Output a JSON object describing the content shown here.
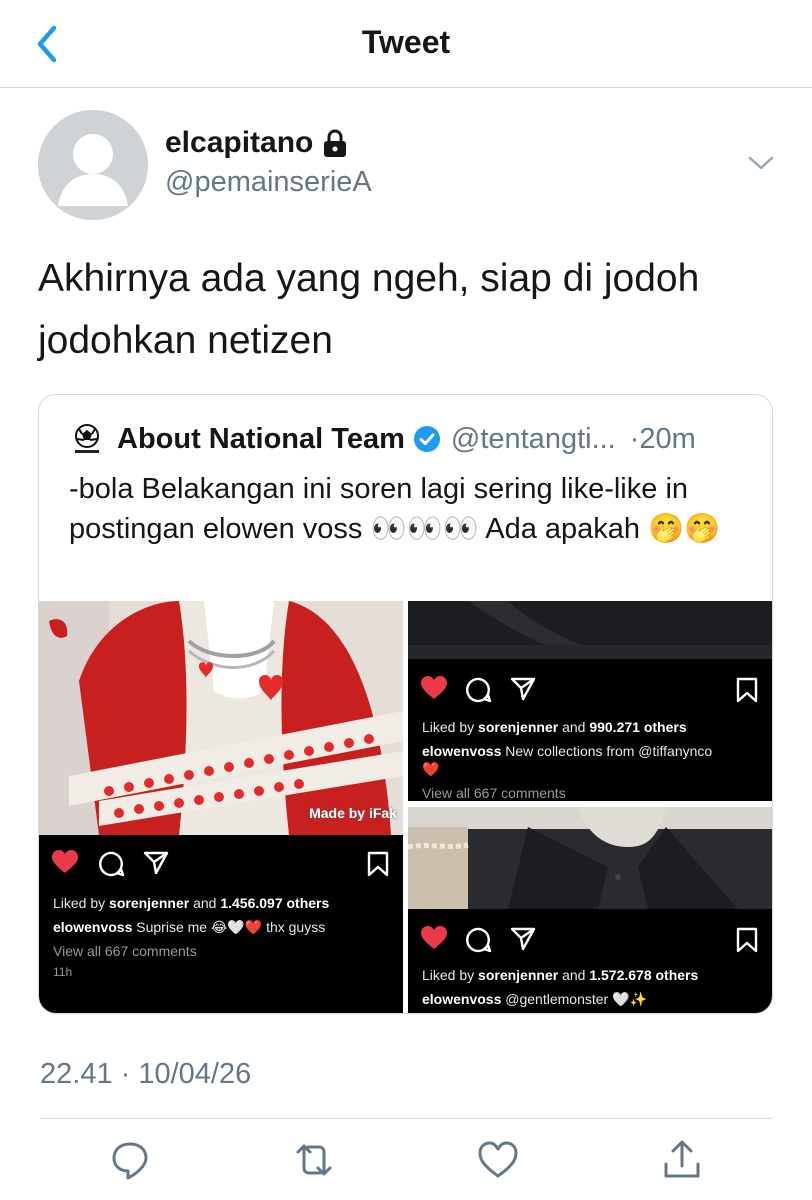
{
  "header": {
    "title": "Tweet"
  },
  "tweet": {
    "display_name": "elcapitano",
    "handle": "@pemainserieA",
    "text": "Akhirnya ada yang ngeh, siap di jodoh jodohkan netizen",
    "timestamp": "22.41 · 10/04/26"
  },
  "quote": {
    "name": "About National Team",
    "handle": "@tentangti...",
    "time": "·20m",
    "text": "-bola Belakangan ini soren lagi sering like-like in postingan elowen voss 👀👀👀 Ada apakah 🤭🤭"
  },
  "posts": {
    "left": {
      "watermark": "Made by iFak",
      "liked_by": "Liked by",
      "liker": "sorenjenner",
      "and_others": "and",
      "count": "1.456.097 others",
      "user": "elowenvoss",
      "caption": "Suprise me 😂🤍❤️ thx guyss",
      "comments": "View all 667 comments",
      "age": "11h"
    },
    "right_top": {
      "liked_by": "Liked by",
      "liker": "sorenjenner",
      "and_others": "and",
      "count": "990.271 others",
      "user": "elowenvoss",
      "caption": "New collections from @tiffanynco",
      "caption_emoji": "❤️",
      "comments": "View all 667 comments"
    },
    "right_bottom": {
      "liked_by": "Liked by",
      "liker": "sorenjenner",
      "and_others": "and",
      "count": "1.572.678 others",
      "user": "elowenvoss",
      "caption": "@gentlemonster 🤍✨"
    }
  },
  "colors": {
    "twitter_blue": "#1d9bf0",
    "heart_red": "#ed3a4b",
    "muted_gray": "#657786",
    "jacket_red": "#c8201f"
  },
  "icons": [
    "back-chevron-icon",
    "lock-icon",
    "chevron-down-icon",
    "verified-badge-icon",
    "reply-icon",
    "retweet-icon",
    "like-icon",
    "share-icon",
    "heart-filled-icon",
    "comment-icon",
    "send-icon",
    "bookmark-icon"
  ]
}
